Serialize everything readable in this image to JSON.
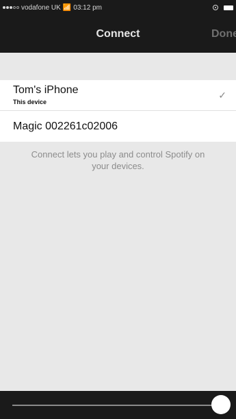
{
  "status_bar": {
    "carrier": "vodafone UK",
    "time": "03:12 pm",
    "signal_bars_filled": 3,
    "signal_bars_total": 5
  },
  "nav": {
    "title": "Connect",
    "done_label": "Done"
  },
  "devices": [
    {
      "name": "Tom's iPhone",
      "subtitle": "This device",
      "selected": true
    },
    {
      "name": "Magic 002261c02006"
    }
  ],
  "info_text": "Connect lets you play and control Spotify on your devices.",
  "volume": {
    "level": 1.0
  },
  "colors": {
    "bar_background": "#1a1a1a",
    "list_background": "#ffffff",
    "page_background": "#e8e8e8",
    "muted_text": "#8c8c8c"
  },
  "icons": {
    "check": "check-icon",
    "wifi": "wifi-icon",
    "lock": "orientation-lock-icon",
    "battery": "battery-icon"
  }
}
